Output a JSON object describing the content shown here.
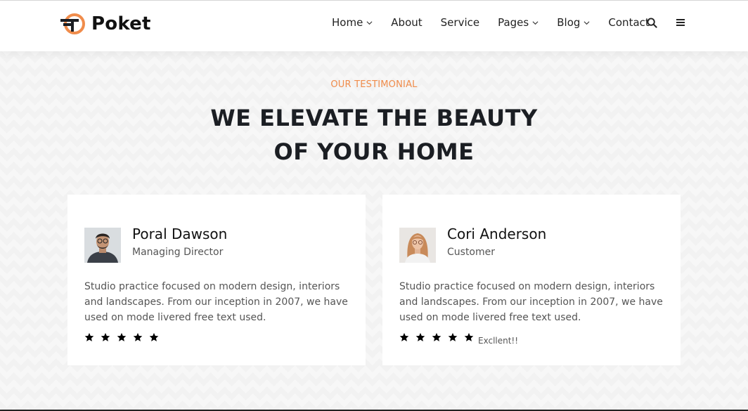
{
  "brand": {
    "name": "Poket",
    "accent_color": "#f08c4b"
  },
  "nav": {
    "items": [
      {
        "label": "Home",
        "has_dropdown": true
      },
      {
        "label": "About",
        "has_dropdown": false
      },
      {
        "label": "Service",
        "has_dropdown": false
      },
      {
        "label": "Pages",
        "has_dropdown": true
      },
      {
        "label": "Blog",
        "has_dropdown": true
      },
      {
        "label": "Contact",
        "has_dropdown": false
      }
    ],
    "icons": [
      "search-icon",
      "hamburger-menu-icon"
    ]
  },
  "section": {
    "eyebrow": "OUR TESTIMONIAL",
    "headline_line1": "WE ELEVATE THE BEAUTY",
    "headline_line2": "OF YOUR HOME"
  },
  "testimonials": [
    {
      "name": "Poral Dawson",
      "role": "Managing Director",
      "quote": "Studio practice focused on modern design, interiors and landscapes. From our inception in 2007, we have used on mode livered free text used.",
      "rating": 5,
      "rating_text": ""
    },
    {
      "name": "Cori Anderson",
      "role": "Customer",
      "quote": "Studio practice focused on modern design, interiors and landscapes. From our inception in 2007, we have used on mode livered free text used.",
      "rating": 5,
      "rating_text": "Excllent!!"
    }
  ]
}
